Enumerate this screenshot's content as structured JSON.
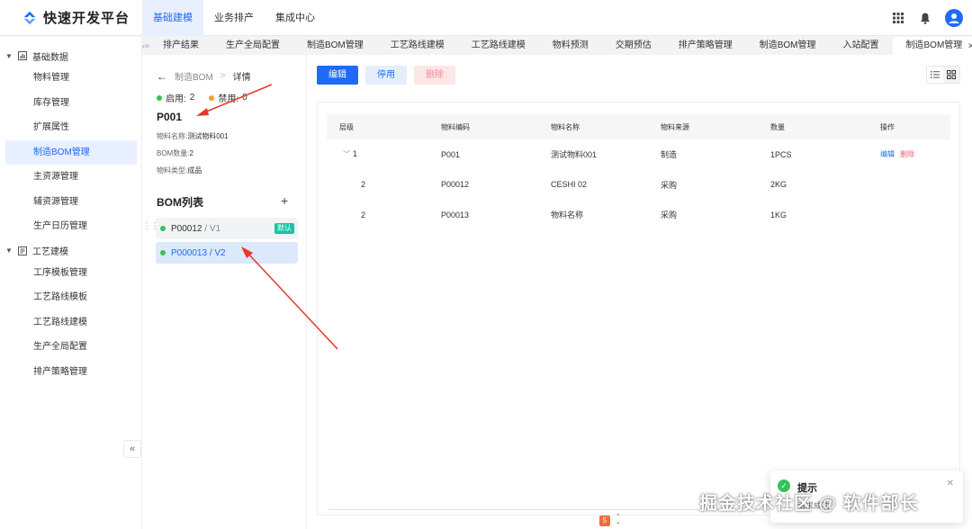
{
  "app": {
    "title": "快速开发平台"
  },
  "topnav": [
    {
      "label": "基础建模",
      "active": true
    },
    {
      "label": "业务排产",
      "active": false
    },
    {
      "label": "集成中心",
      "active": false
    }
  ],
  "sidebar": {
    "groups": [
      {
        "label": "基础数据",
        "icon": "chart-icon",
        "items": [
          "物料管理",
          "库存管理",
          "扩展属性",
          "制造BOM管理",
          "主资源管理",
          "辅资源管理",
          "生产日历管理"
        ],
        "active_index": 3
      },
      {
        "label": "工艺建模",
        "icon": "process-icon",
        "items": [
          "工序模板管理",
          "工艺路线模板",
          "工艺路线建模",
          "生产全局配置",
          "排产策略管理"
        ]
      }
    ]
  },
  "tabs": [
    "排产结果",
    "生产全局配置",
    "制造BOM管理",
    "工艺路线建模",
    "工艺路线建模",
    "物料预测",
    "交期预估",
    "排产策略管理",
    "制造BOM管理",
    "入站配置",
    "制造BOM管理"
  ],
  "active_tab_index": 10,
  "detail": {
    "breadcrumb": {
      "parent": "制造BOM",
      "current": "详情"
    },
    "enabled_label": "启用:",
    "enabled_count": "2",
    "disabled_label": "禁用:",
    "disabled_count": "0",
    "code": "P001",
    "fields": [
      {
        "label": "物料名称:",
        "value": "测试物料001"
      },
      {
        "label": "BOM数量:",
        "value": "2"
      },
      {
        "label": "物料类型:",
        "value": "成品"
      }
    ],
    "list_title": "BOM列表",
    "bom_list": [
      {
        "code": "P00012",
        "version": " / V1",
        "badge": "默认"
      },
      {
        "code": "P000013",
        "version": " / V2",
        "badge": ""
      }
    ]
  },
  "toolbar": {
    "edit": "编辑",
    "disable": "停用",
    "delete": "删除"
  },
  "table": {
    "headers": [
      "层级",
      "物料编码",
      "物料名称",
      "物料来源",
      "数量",
      "操作"
    ],
    "rows": [
      {
        "level": "1",
        "code": "P001",
        "name": "测试物料001",
        "source": "制造",
        "qty": "1PCS",
        "edit": "编辑",
        "delete": "删除"
      },
      {
        "level": "2",
        "code": "P00012",
        "name": "CESHI 02",
        "source": "采购",
        "qty": "2KG"
      },
      {
        "level": "2",
        "code": "P00013",
        "name": "物料名称",
        "source": "采购",
        "qty": "1KG"
      }
    ]
  },
  "toast": {
    "title": "提示",
    "message": "请求成功"
  },
  "watermark": "掘金技术社区 @ 软件部长",
  "colors": {
    "primary": "#1e6bf5",
    "success": "#35c25a",
    "warning": "#f39c3a",
    "danger": "#f0606e",
    "teal": "#17c3a6"
  }
}
